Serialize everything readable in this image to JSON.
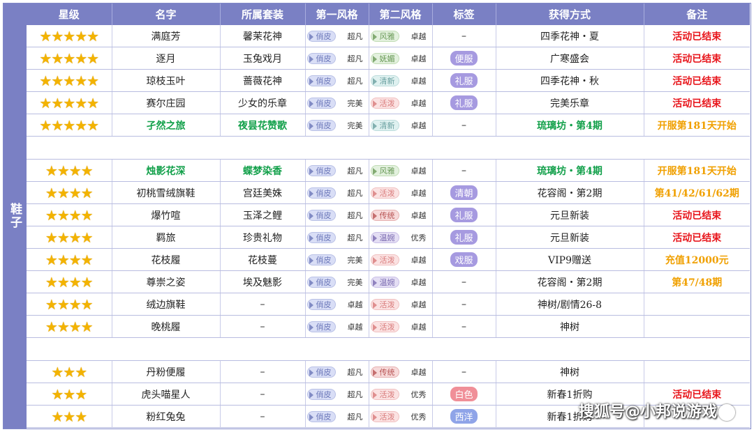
{
  "category": "鞋子",
  "headers": [
    "星级",
    "名字",
    "所属套装",
    "第一风格",
    "第二风格",
    "标签",
    "获得方式",
    "备注"
  ],
  "colors": {
    "header_bg": "#7a80c4",
    "green": "#12a04a",
    "red": "#e8161c",
    "orange": "#f0a000",
    "star": "#f3b300"
  },
  "groups": [
    {
      "rows": [
        {
          "stars": "★★★★★",
          "name": "满庭芳",
          "suit": "馨茉花神",
          "s1": "俏皮",
          "s1c": "blue",
          "l1": "超凡",
          "s2": "风雅",
          "s2c": "green",
          "l2": "卓越",
          "tag": "–",
          "tagc": "",
          "source": "四季花神・夏",
          "note": "活动已结束",
          "notec": "red",
          "namec": "",
          "sourcec": ""
        },
        {
          "stars": "★★★★★",
          "name": "逐月",
          "suit": "玉兔戏月",
          "s1": "俏皮",
          "s1c": "blue",
          "l1": "超凡",
          "s2": "妩媚",
          "s2c": "green",
          "l2": "卓越",
          "tag": "便服",
          "tagc": "purple",
          "source": "广寒盛会",
          "note": "活动已结束",
          "notec": "red",
          "namec": "",
          "sourcec": ""
        },
        {
          "stars": "★★★★★",
          "name": "琼枝玉叶",
          "suit": "蔷薇花神",
          "s1": "俏皮",
          "s1c": "blue",
          "l1": "超凡",
          "s2": "清新",
          "s2c": "teal",
          "l2": "卓越",
          "tag": "礼服",
          "tagc": "purple",
          "source": "四季花神・秋",
          "note": "活动已结束",
          "notec": "red",
          "namec": "",
          "sourcec": ""
        },
        {
          "stars": "★★★★★",
          "name": "赛尔庄园",
          "suit": "少女的乐章",
          "s1": "俏皮",
          "s1c": "blue",
          "l1": "完美",
          "s2": "活泼",
          "s2c": "pink",
          "l2": "卓越",
          "tag": "礼服",
          "tagc": "purple",
          "source": "完美乐章",
          "note": "活动已结束",
          "notec": "red",
          "namec": "",
          "sourcec": ""
        },
        {
          "stars": "★★★★★",
          "name": "孑然之旅",
          "suit": "夜昙花赞歌",
          "s1": "俏皮",
          "s1c": "blue",
          "l1": "完美",
          "s2": "清新",
          "s2c": "teal",
          "l2": "卓越",
          "tag": "–",
          "tagc": "",
          "source": "琉璃坊・第4期",
          "note": "开服第181天开始",
          "notec": "orange",
          "namec": "green",
          "sourcec": "green"
        }
      ]
    },
    {
      "rows": [
        {
          "stars": "★★★★",
          "name": "烛影花深",
          "suit": "蝶梦染香",
          "s1": "俏皮",
          "s1c": "blue",
          "l1": "超凡",
          "s2": "风雅",
          "s2c": "green",
          "l2": "卓越",
          "tag": "–",
          "tagc": "",
          "source": "琉璃坊・第4期",
          "note": "开服第181天开始",
          "notec": "orange",
          "namec": "green",
          "sourcec": "green"
        },
        {
          "stars": "★★★★",
          "name": "初桃雪绒旗鞋",
          "suit": "宫廷美姝",
          "s1": "俏皮",
          "s1c": "blue",
          "l1": "超凡",
          "s2": "活泼",
          "s2c": "pink",
          "l2": "卓越",
          "tag": "清朝",
          "tagc": "purple",
          "source": "花容阁・第2期",
          "note": "第41/42/61/62期",
          "notec": "orange",
          "namec": "",
          "sourcec": ""
        },
        {
          "stars": "★★★★",
          "name": "爆竹喧",
          "suit": "玉泽之鲤",
          "s1": "俏皮",
          "s1c": "blue",
          "l1": "超凡",
          "s2": "传统",
          "s2c": "red",
          "l2": "卓越",
          "tag": "礼服",
          "tagc": "purple",
          "source": "元旦新装",
          "note": "活动已结束",
          "notec": "red",
          "namec": "",
          "sourcec": ""
        },
        {
          "stars": "★★★★",
          "name": "羁旅",
          "suit": "珍贵礼物",
          "s1": "俏皮",
          "s1c": "blue",
          "l1": "超凡",
          "s2": "温婉",
          "s2c": "purple",
          "l2": "优秀",
          "tag": "礼服",
          "tagc": "purple",
          "source": "元旦新装",
          "note": "活动已结束",
          "notec": "red",
          "namec": "",
          "sourcec": ""
        },
        {
          "stars": "★★★★",
          "name": "花枝履",
          "suit": "花枝蔓",
          "s1": "俏皮",
          "s1c": "blue",
          "l1": "完美",
          "s2": "活泼",
          "s2c": "pink",
          "l2": "卓越",
          "tag": "戏服",
          "tagc": "purple",
          "source": "VIP9赠送",
          "note": "充值12000元",
          "notec": "orange",
          "namec": "",
          "sourcec": ""
        },
        {
          "stars": "★★★★",
          "name": "尊崇之姿",
          "suit": "埃及魅影",
          "s1": "俏皮",
          "s1c": "blue",
          "l1": "完美",
          "s2": "温婉",
          "s2c": "purple",
          "l2": "卓越",
          "tag": "–",
          "tagc": "",
          "source": "花容阁・第2期",
          "note": "第47/48期",
          "notec": "orange",
          "namec": "",
          "sourcec": ""
        },
        {
          "stars": "★★★★",
          "name": "绒边旗鞋",
          "suit": "–",
          "s1": "俏皮",
          "s1c": "blue",
          "l1": "卓越",
          "s2": "活泼",
          "s2c": "pink",
          "l2": "卓越",
          "tag": "–",
          "tagc": "",
          "source": "神树/剧情26-8",
          "note": "",
          "notec": "",
          "namec": "",
          "sourcec": ""
        },
        {
          "stars": "★★★★",
          "name": "晚桃履",
          "suit": "–",
          "s1": "俏皮",
          "s1c": "blue",
          "l1": "卓越",
          "s2": "活泼",
          "s2c": "pink",
          "l2": "卓越",
          "tag": "–",
          "tagc": "",
          "source": "神树",
          "note": "",
          "notec": "",
          "namec": "",
          "sourcec": ""
        }
      ]
    },
    {
      "rows": [
        {
          "stars": "★★★",
          "name": "丹粉便履",
          "suit": "–",
          "s1": "俏皮",
          "s1c": "blue",
          "l1": "超凡",
          "s2": "传统",
          "s2c": "red",
          "l2": "卓越",
          "tag": "–",
          "tagc": "",
          "source": "神树",
          "note": "",
          "notec": "",
          "namec": "",
          "sourcec": ""
        },
        {
          "stars": "★★★",
          "name": "虎头喵星人",
          "suit": "–",
          "s1": "俏皮",
          "s1c": "blue",
          "l1": "超凡",
          "s2": "活泼",
          "s2c": "pink",
          "l2": "优秀",
          "tag": "白色",
          "tagc": "pink",
          "source": "新春1折购",
          "note": "活动已结束",
          "notec": "red",
          "namec": "",
          "sourcec": ""
        },
        {
          "stars": "★★★",
          "name": "粉红兔兔",
          "suit": "–",
          "s1": "俏皮",
          "s1c": "blue",
          "l1": "超凡",
          "s2": "活泼",
          "s2c": "pink",
          "l2": "优秀",
          "tag": "西洋",
          "tagc": "lblue",
          "source": "新春1折购",
          "note": "",
          "notec": "",
          "namec": "",
          "sourcec": ""
        }
      ]
    }
  ],
  "watermark": "搜狐号@小邦说游戏"
}
